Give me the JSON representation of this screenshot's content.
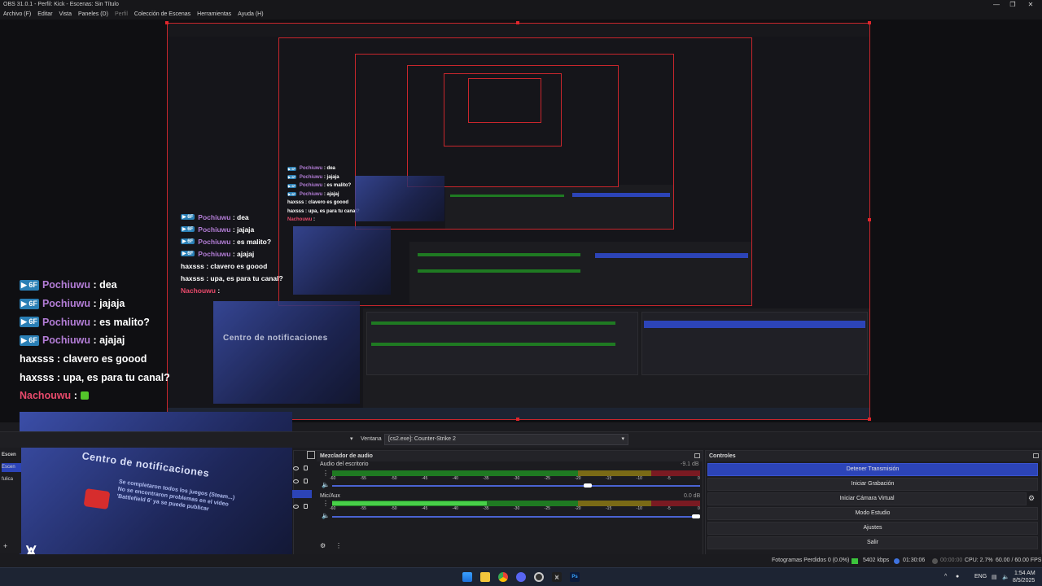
{
  "window": {
    "title": "OBS 31.0.1 - Perfil: Kick - Escenas: Sin Título",
    "minimize": "—",
    "maximize": "❐",
    "close": "✕"
  },
  "menu": {
    "items": [
      "Archivo (F)",
      "Editar",
      "Vista",
      "Paneles (D)",
      "Perfil",
      "Colección de Escenas",
      "Herramientas",
      "Ayuda (H)"
    ]
  },
  "chat": {
    "badge": "▶ 6F",
    "lines": [
      {
        "user": "Pochiuwu",
        "msg": ": dea",
        "badge": true,
        "color": "#b37dd6"
      },
      {
        "user": "Pochiuwu",
        "msg": ": jajaja",
        "badge": true,
        "color": "#b37dd6"
      },
      {
        "user": "Pochiuwu",
        "msg": ": es malito?",
        "badge": true,
        "color": "#b37dd6"
      },
      {
        "user": "Pochiuwu",
        "msg": ": ajajaj",
        "badge": true,
        "color": "#b37dd6"
      },
      {
        "user": "haxsss",
        "msg": ": clavero es goood",
        "badge": false,
        "color": "#ffffff"
      },
      {
        "user": "haxsss",
        "msg": ": upa, es para tu canal?",
        "badge": false,
        "color": "#ffffff"
      },
      {
        "user": "Nachouwu",
        "msg": ":",
        "badge": false,
        "color": "#e84a6b"
      }
    ]
  },
  "notification": {
    "title": "Centro de notificaciones",
    "text": "Se completaron todos los juegos (Steam...) No se encontraron problemas en el video 'Battlefield 6' ya se puede publicar"
  },
  "source_toolbar": {
    "label": "Ventana",
    "value": "[cs2.exe]: Counter-Strike 2"
  },
  "left_panel": {
    "header": "Escen",
    "items": [
      "Escen",
      "fulica"
    ]
  },
  "mixer": {
    "title": "Mezclador de audio",
    "ticks": [
      "-60",
      "-55",
      "-50",
      "-45",
      "-40",
      "-35",
      "-30",
      "-25",
      "-20",
      "-15",
      "-10",
      "-5",
      "0"
    ],
    "channels": [
      {
        "name": "Audio del escritorio",
        "db": "-9.1 dB",
        "level": 0.0,
        "volume": 0.7
      },
      {
        "name": "Mic/Aux",
        "db": "0.0 dB",
        "level": 0.42,
        "volume": 1.0
      }
    ]
  },
  "controls": {
    "title": "Controles",
    "buttons": [
      {
        "label": "Detener Transmisión",
        "active": true
      },
      {
        "label": "Iniciar Grabación",
        "active": false
      },
      {
        "label": "Iniciar Cámara Virtual",
        "active": false
      },
      {
        "label": "Modo Estudio",
        "active": false
      },
      {
        "label": "Ajustes",
        "active": false
      },
      {
        "label": "Salir",
        "active": false
      }
    ]
  },
  "status": {
    "dropped": "Fotogramas Perdidos 0 (0.0%)",
    "bitrate": "5402 kbps",
    "stream_time": "01:30:06",
    "rec_time": "00:00:00",
    "cpu": "CPU: 2.7%",
    "fps": "60.00 / 60.00 FPS"
  },
  "taskbar": {
    "lang": "ENG",
    "time": "1:54 AM",
    "date": "8/5/2025",
    "apps": [
      "windows-start",
      "file-explorer",
      "chrome",
      "discord",
      "obs",
      "kick",
      "photoshop"
    ]
  }
}
